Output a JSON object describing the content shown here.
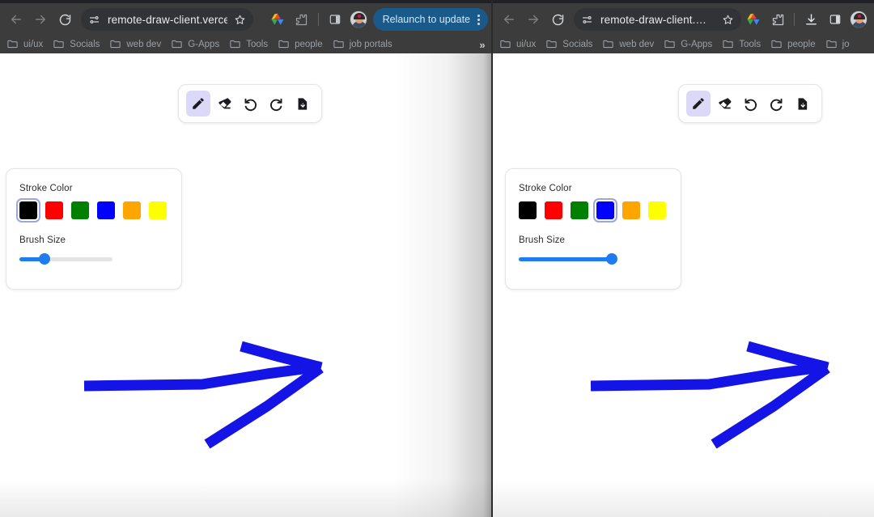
{
  "windows": [
    {
      "id": "left",
      "omnibox": {
        "url": "remote-draw-client.verce…",
        "tune_icon": "tune-icon",
        "star_icon": "bookmark-star-icon"
      },
      "nav": {
        "back": "back-arrow-icon",
        "forward": "forward-arrow-icon",
        "reload": "reload-icon"
      },
      "actions": {
        "drive_icon": "google-drive-icon",
        "extensions_icon": "extensions-puzzle-icon",
        "side_panel_icon": "side-panel-icon",
        "avatar": "profile-avatar",
        "relaunch_label": "Relaunch to update",
        "menu_icon": "three-dot-menu-icon",
        "has_download_icon": false,
        "has_relaunch": true
      },
      "bookmarks": [
        "ui/ux",
        "Socials",
        "web dev",
        "G-Apps",
        "Tools",
        "people",
        "job portals"
      ],
      "bookmarks_overflow": "»",
      "app": {
        "tools": [
          {
            "name": "pencil-tool",
            "glyph": "pencil",
            "active": true
          },
          {
            "name": "eraser-tool",
            "glyph": "eraser",
            "active": false
          },
          {
            "name": "undo-tool",
            "glyph": "undo",
            "active": false
          },
          {
            "name": "redo-tool",
            "glyph": "redo",
            "active": false
          },
          {
            "name": "save-tool",
            "glyph": "download-file",
            "active": false
          }
        ],
        "stroke_color_label": "Stroke Color",
        "brush_size_label": "Brush Size",
        "colors": [
          {
            "name": "black",
            "hex": "#000000",
            "selected": true
          },
          {
            "name": "red",
            "hex": "#FF0000",
            "selected": false
          },
          {
            "name": "green",
            "hex": "#008000",
            "selected": false
          },
          {
            "name": "blue",
            "hex": "#0000FF",
            "selected": false
          },
          {
            "name": "orange",
            "hex": "#FFA500",
            "selected": false
          },
          {
            "name": "yellow",
            "hex": "#FFFF00",
            "selected": false
          }
        ],
        "brush_size_percent": 27,
        "drawing_color": "#1414E6",
        "drawing_description": "blue hand-drawn right-pointing arrow"
      }
    },
    {
      "id": "right",
      "omnibox": {
        "url": "remote-draw-client.…",
        "tune_icon": "tune-icon",
        "star_icon": "bookmark-star-icon"
      },
      "nav": {
        "back": "back-arrow-icon",
        "forward": "forward-arrow-icon",
        "reload": "reload-icon"
      },
      "actions": {
        "drive_icon": "google-drive-icon",
        "extensions_icon": "extensions-puzzle-icon",
        "download_icon": "download-icon",
        "side_panel_icon": "side-panel-icon",
        "avatar": "profile-avatar",
        "has_download_icon": true,
        "has_relaunch": false
      },
      "bookmarks": [
        "ui/ux",
        "Socials",
        "web dev",
        "G-Apps",
        "Tools",
        "people",
        "jo"
      ],
      "bookmarks_overflow": "",
      "app": {
        "tools": [
          {
            "name": "pencil-tool",
            "glyph": "pencil",
            "active": true
          },
          {
            "name": "eraser-tool",
            "glyph": "eraser",
            "active": false
          },
          {
            "name": "undo-tool",
            "glyph": "undo",
            "active": false
          },
          {
            "name": "redo-tool",
            "glyph": "redo",
            "active": false
          },
          {
            "name": "save-tool",
            "glyph": "download-file",
            "active": false
          }
        ],
        "stroke_color_label": "Stroke Color",
        "brush_size_label": "Brush Size",
        "colors": [
          {
            "name": "black",
            "hex": "#000000",
            "selected": false
          },
          {
            "name": "red",
            "hex": "#FF0000",
            "selected": false
          },
          {
            "name": "green",
            "hex": "#008000",
            "selected": false
          },
          {
            "name": "blue",
            "hex": "#0000FF",
            "selected": true
          },
          {
            "name": "orange",
            "hex": "#FFA500",
            "selected": false
          },
          {
            "name": "yellow",
            "hex": "#FFFF00",
            "selected": false
          }
        ],
        "brush_size_percent": 100,
        "drawing_color": "#1414E6",
        "drawing_description": "blue hand-drawn right-pointing arrow"
      }
    }
  ],
  "theme": {
    "chrome_bg": "#3c3c3c",
    "omnibox_bg": "#323336",
    "bookmark_text": "#9aa0a6",
    "relaunch_bg": "#1a5a8a",
    "accent_blue": "#1f7bf0",
    "tool_active_bg": "#dcd9f8",
    "canvas_bg": "#ffffff"
  }
}
